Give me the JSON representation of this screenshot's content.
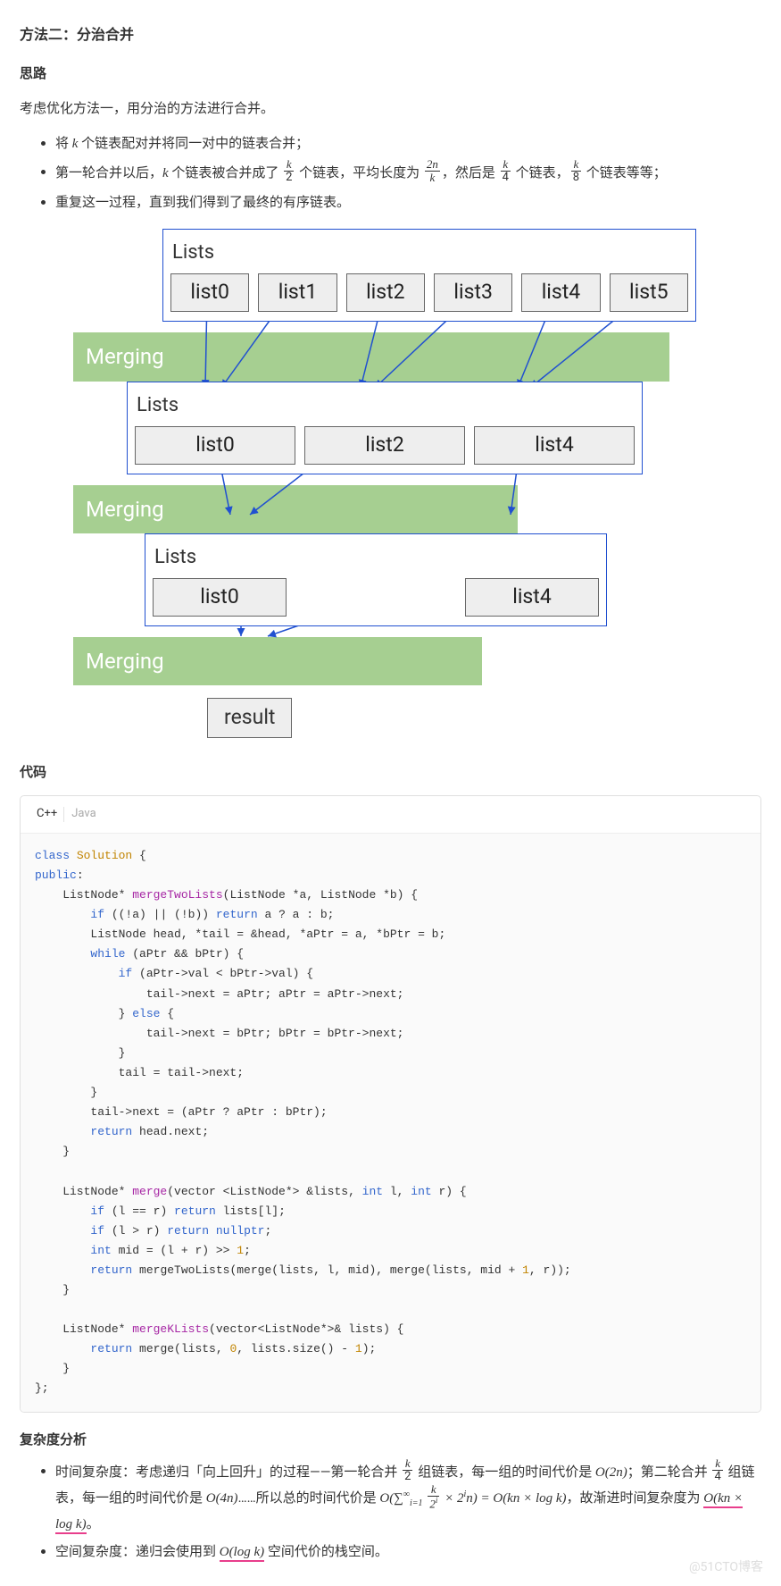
{
  "title": "方法二：分治合并",
  "idea_heading": "思路",
  "intro": "考虑优化方法一，用分治的方法进行合并。",
  "bullets": {
    "b1": "个链表配对并将同一对中的链表合并；",
    "b2_a": "第一轮合并以后，",
    "b2_b": " 个链表被合并成了 ",
    "b2_c": " 个链表，平均长度为 ",
    "b2_d": "，然后是 ",
    "b2_e": " 个链表，",
    "b2_f": " 个链表等等；",
    "b3": "重复这一过程，直到我们得到了最终的有序链表。"
  },
  "diagram": {
    "lists_label": "Lists",
    "merging_label": "Merging",
    "row1": [
      "list0",
      "list1",
      "list2",
      "list3",
      "list4",
      "list5"
    ],
    "row2": [
      "list0",
      "list2",
      "list4"
    ],
    "row3": [
      "list0",
      "list4"
    ],
    "result": "result"
  },
  "code_heading": "代码",
  "tabs": {
    "cpp": "C++",
    "java": "Java"
  },
  "analysis_heading": "复杂度分析",
  "analysis": {
    "time_a": "时间复杂度：考虑递归「向上回升」的过程——第一轮合并 ",
    "time_b": " 组链表，每一组的时间代价是 ",
    "time_c": "；第二轮合并 ",
    "time_d": " 组链表，每一组的时间代价是 ",
    "time_e": "……所以总的时间代价是 ",
    "time_f": "，故渐进时间复杂度为 ",
    "time_g": "。",
    "space_a": "空间复杂度：递归会使用到 ",
    "space_b": " 空间代价的栈空间。"
  },
  "math": {
    "k": "k",
    "O2n": "O(2n)",
    "O4n": "O(4n)",
    "Osum": "O(∑",
    "sum_sup": "∞",
    "sum_sub": "i=1",
    "sum_tail": " × 2",
    "sum_i": "i",
    "sum_n": "n) =",
    "Oknlogk": "O(kn × log k)",
    "Ologk": "O(log k)",
    "frac_k2_n": "k",
    "frac_k2_d": "2",
    "frac_2nk_n": "2n",
    "frac_2nk_d": "k",
    "frac_k4_n": "k",
    "frac_k4_d": "4",
    "frac_k8_n": "k",
    "frac_k8_d": "8",
    "frac_k2i_n": "k",
    "frac_k2i_d": "2"
  },
  "watermark": "@51CTO博客"
}
